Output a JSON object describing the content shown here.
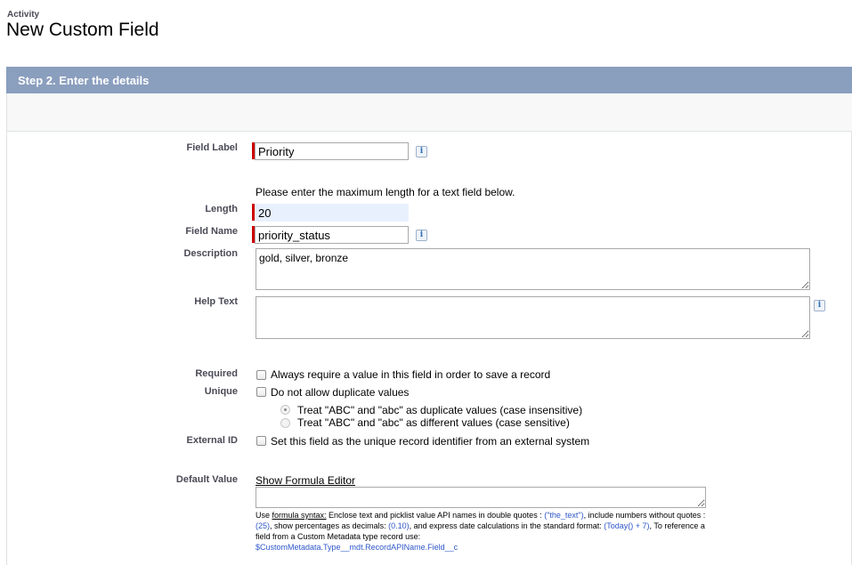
{
  "header": {
    "object_label": "Activity",
    "page_title": "New Custom Field"
  },
  "step": {
    "title": "Step 2. Enter the details"
  },
  "fields": {
    "field_label": {
      "label": "Field Label",
      "value": "Priority"
    },
    "length_hint": "Please enter the maximum length for a text field below.",
    "length": {
      "label": "Length",
      "value": "20"
    },
    "field_name": {
      "label": "Field Name",
      "value": "priority_status"
    },
    "description": {
      "label": "Description",
      "value": "gold, silver, bronze"
    },
    "help_text": {
      "label": "Help Text",
      "value": ""
    },
    "required": {
      "label": "Required",
      "text": "Always require a value in this field in order to save a record",
      "checked": false
    },
    "unique": {
      "label": "Unique",
      "text": "Do not allow duplicate values",
      "checked": false,
      "options": [
        {
          "text": "Treat \"ABC\" and \"abc\" as duplicate values (case insensitive)",
          "selected": true
        },
        {
          "text": "Treat \"ABC\" and \"abc\" as different values (case sensitive)",
          "selected": false
        }
      ]
    },
    "external_id": {
      "label": "External ID",
      "text": "Set this field as the unique record identifier from an external system",
      "checked": false
    },
    "default_value": {
      "label": "Default Value",
      "formula_link": "Show Formula Editor",
      "value": "",
      "help": {
        "p1": "Use ",
        "formula_syntax": "formula syntax:",
        "p2": " Enclose text and picklist value API names in double quotes : ",
        "ex1": "(\"the_text\")",
        "p3": ", include numbers without quotes : ",
        "ex2": "(25)",
        "p4": ", show percentages as decimals: ",
        "ex3": "(0.10)",
        "p5": ", and express date calculations in the standard format: ",
        "ex4": "(Today() + 7)",
        "p6": ", To reference a field from a Custom Metadata type record use: ",
        "ex5": "$CustomMetadata.Type__mdt.RecordAPIName.Field__c"
      }
    }
  },
  "icons": {
    "info": "i"
  },
  "colors": {
    "header_bar": "#8a9ebe",
    "required_bar": "#cc0000",
    "link_blue": "#2e57c9"
  }
}
